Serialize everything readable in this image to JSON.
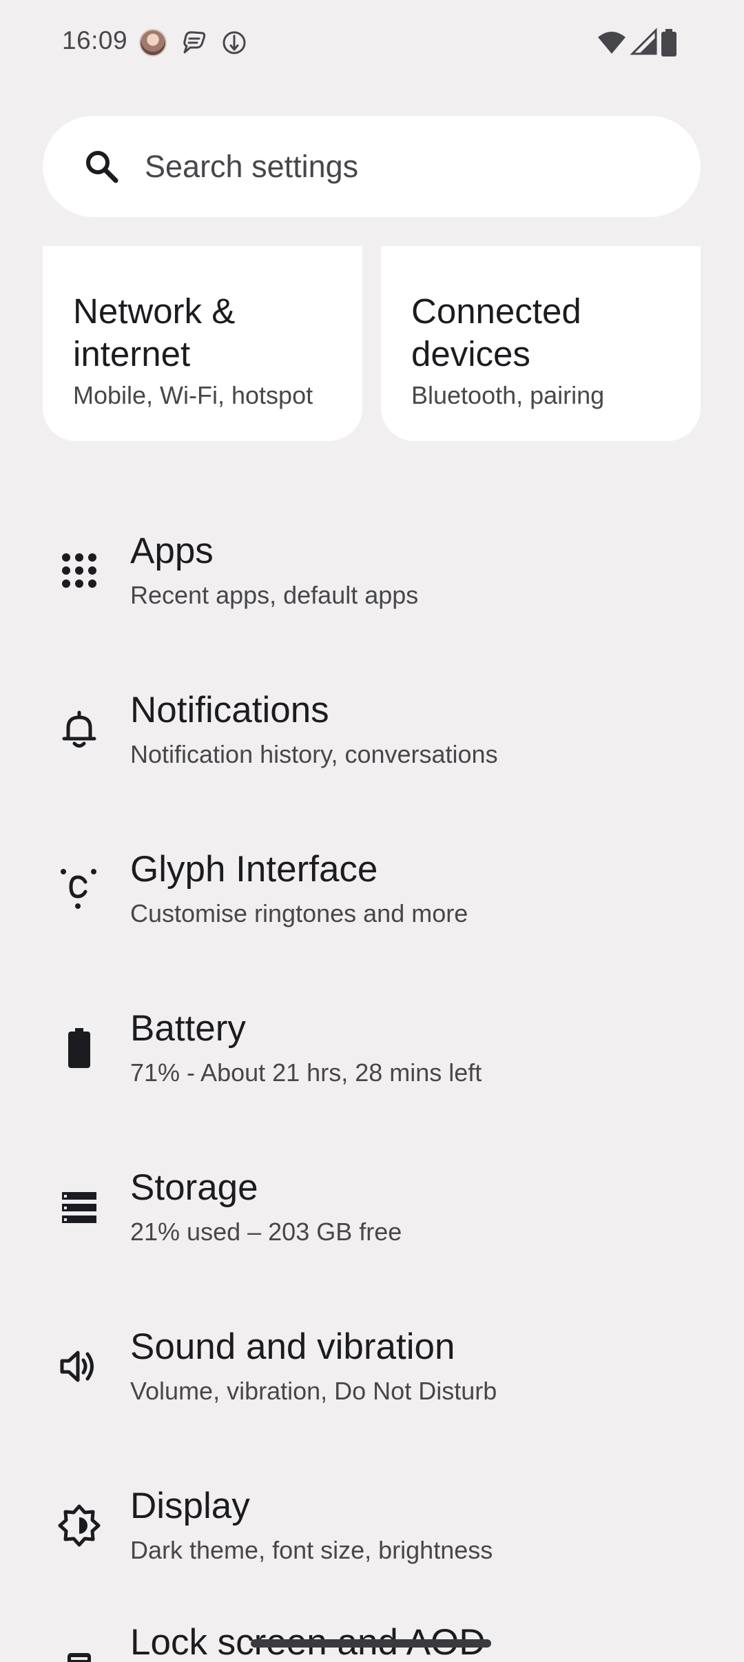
{
  "status_bar": {
    "time": "16:09",
    "notification_icons": [
      "avatar-icon",
      "chat-icon",
      "vpn-key-icon"
    ],
    "system_icons": [
      "wifi-icon",
      "cellular-signal-icon",
      "battery-icon"
    ]
  },
  "search": {
    "placeholder": "Search settings"
  },
  "cards": [
    {
      "title": "Network & internet",
      "subtitle": "Mobile, Wi-Fi, hotspot"
    },
    {
      "title": "Connected devices",
      "subtitle": "Bluetooth, pairing"
    }
  ],
  "items": [
    {
      "icon": "apps-grid-icon",
      "title": "Apps",
      "subtitle": "Recent apps, default apps"
    },
    {
      "icon": "bell-icon",
      "title": "Notifications",
      "subtitle": "Notification history, conversations"
    },
    {
      "icon": "glyph-icon",
      "title": "Glyph Interface",
      "subtitle": "Customise ringtones and more"
    },
    {
      "icon": "battery-icon",
      "title": "Battery",
      "subtitle": "71% - About 21 hrs, 28 mins left"
    },
    {
      "icon": "storage-icon",
      "title": "Storage",
      "subtitle": "21% used – 203 GB free"
    },
    {
      "icon": "speaker-icon",
      "title": "Sound and vibration",
      "subtitle": "Volume, vibration, Do Not Disturb"
    },
    {
      "icon": "brightness-icon",
      "title": "Display",
      "subtitle": "Dark theme, font size, brightness"
    },
    {
      "icon": "lock-screen-icon",
      "title": "Lock screen and AOD",
      "subtitle": ""
    }
  ],
  "colors": {
    "background": "#f1eff0",
    "card": "#ffffff",
    "text_primary": "#1c1b1f",
    "text_secondary": "#47464a"
  }
}
